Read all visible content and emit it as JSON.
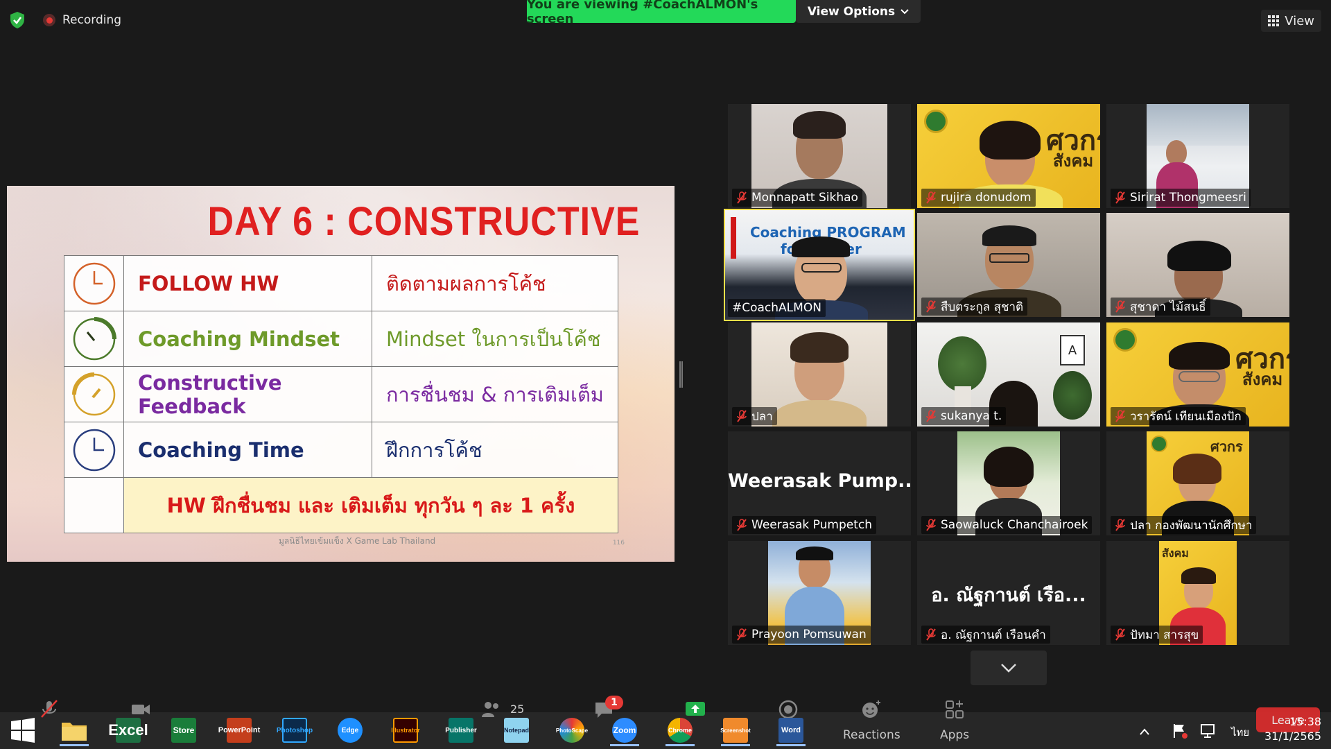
{
  "topbar": {
    "recording_label": "Recording",
    "viewing_banner": "You are viewing #CoachALMON's screen",
    "view_options_label": "View Options",
    "view_label": "View"
  },
  "slide": {
    "title": "DAY 6 : CONSTRUCTIVE",
    "rows": [
      {
        "en": "FOLLOW HW",
        "th": "ติดตามผลการโค้ช",
        "color": "#c41a1a",
        "clock_color": "#d4622a"
      },
      {
        "en": "Coaching Mindset",
        "th": "Mindset ในการเป็นโค้ช",
        "color": "#6e9a2a",
        "clock_color": "#4b7a2a"
      },
      {
        "en": "Constructive Feedback",
        "th": "การชื่นชม & การเติมเต็ม",
        "color": "#7a2aa0",
        "clock_color": "#d4a12a"
      },
      {
        "en": "Coaching Time",
        "th": "ฝึกการโค้ช",
        "color": "#1a2e6e",
        "clock_color": "#2a3e7e"
      }
    ],
    "hw_line": "HW ฝึกชื่นชม และ เติมเต็ม ทุกวัน ๆ ละ 1 ครั้ง",
    "footer": "มูลนิธิไทยเข้มแข็ง X Game Lab Thailand",
    "page_num": "116"
  },
  "participants": [
    {
      "name": "Monnapatt Sikhao",
      "muted": true
    },
    {
      "name": "rujira donudom",
      "muted": true
    },
    {
      "name": "Sirirat Thongmeesri",
      "muted": true
    },
    {
      "name": "#CoachALMON",
      "muted": false,
      "active": true
    },
    {
      "name": "สืบตระกูล สุชาติ",
      "muted": true
    },
    {
      "name": "สุชาดา ไม้สนธิ์",
      "muted": true
    },
    {
      "name": "ปลา",
      "muted": true
    },
    {
      "name": "sukanya t.",
      "muted": true
    },
    {
      "name": "วรารัตน์ เทียนเมืองปัก",
      "muted": true
    },
    {
      "name": "Weerasak Pumpetch",
      "muted": true,
      "big_name": "Weerasak  Pump..."
    },
    {
      "name": "Saowaluck Chanchairoek",
      "muted": true
    },
    {
      "name": "ปลา กองพัฒนานักศึกษา",
      "muted": true
    },
    {
      "name": "Prayoon Pomsuwan",
      "muted": true
    },
    {
      "name": "อ. ณัฐกานต์  เรือนคำ",
      "muted": true,
      "big_name": "อ. ณัฐกานต์  เรือ..."
    },
    {
      "name": "ปัทมา สารสุข",
      "muted": true
    }
  ],
  "yellow_banner": {
    "big": "ศวกร",
    "sub": "สังคม"
  },
  "coach_banner": {
    "line1": "Coaching PROGRAM",
    "line2": "for Leader"
  },
  "zoom_toolbar": {
    "participants_count": "25",
    "chat_badge": "1",
    "reactions_label": "Reactions",
    "apps_label": "Apps",
    "leave_label": "Leave"
  },
  "taskbar": {
    "time": "15:38",
    "date": "31/1/2565",
    "lang": "ไทย",
    "apps": [
      "Excel",
      "Store",
      "PowerPoint",
      "Photoshop",
      "Edge",
      "Illustrator",
      "Publisher",
      "Notepad",
      "PhotoScape",
      "Zoom",
      "Chrome",
      "Screenshot",
      "Word"
    ]
  }
}
